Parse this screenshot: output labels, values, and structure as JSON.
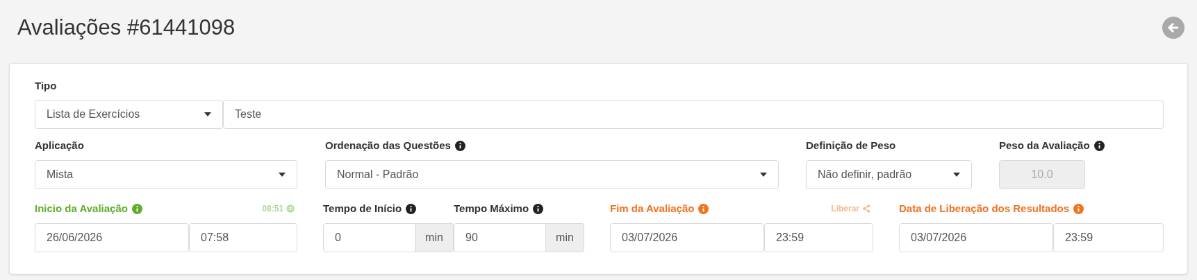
{
  "title": "Avaliações #61441098",
  "tipo": {
    "label": "Tipo",
    "select": "Lista de Exercícios",
    "text": "Teste"
  },
  "row2": [
    {
      "kind": "select",
      "label": "Aplicação",
      "info": false,
      "value": "Mista"
    },
    {
      "kind": "select",
      "label": "Ordenação das Questões",
      "info": true,
      "value": "Normal - Padrão"
    },
    {
      "kind": "select",
      "label": "Definição de Peso",
      "info": false,
      "value": "Não definir, padrão"
    },
    {
      "kind": "readonly",
      "label": "Peso da Avaliação",
      "info": true,
      "value": "10.0"
    }
  ],
  "row3": [
    {
      "kind": "datetime",
      "label": "Inicio da Avaliação",
      "color": "#5fad2f",
      "hint": {
        "kind": "globe",
        "text": "08:51"
      },
      "date": "26/06/2026",
      "time": "07:58"
    },
    {
      "kind": "minutes",
      "label": "Tempo de Início",
      "value": "0",
      "unit": "min"
    },
    {
      "kind": "minutes",
      "label": "Tempo Máximo",
      "value": "90",
      "unit": "min"
    },
    {
      "kind": "datetime",
      "label": "Fim da Avaliação",
      "color": "#f0731f",
      "hint": {
        "kind": "share",
        "text": "Liberar"
      },
      "date": "03/07/2026",
      "time": "23:59"
    },
    {
      "kind": "datetime",
      "label": "Data de Liberação dos Resultados",
      "color": "#f0731f",
      "date": "03/07/2026",
      "time": "23:59"
    }
  ]
}
